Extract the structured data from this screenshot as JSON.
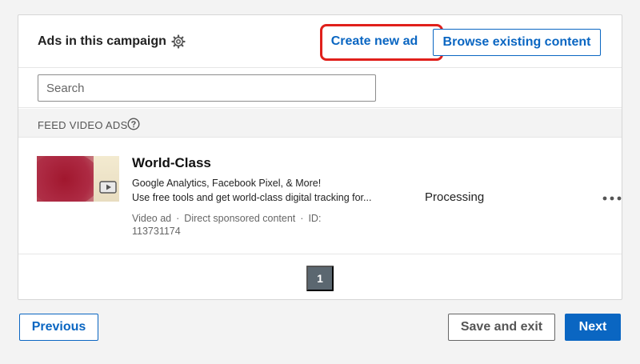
{
  "header": {
    "title": "Ads in this campaign",
    "create_label": "Create new ad",
    "browse_label": "Browse existing content"
  },
  "search": {
    "placeholder": "Search"
  },
  "section": {
    "label": "FEED VIDEO ADS"
  },
  "ad": {
    "title": "World-Class",
    "line1": "Google Analytics, Facebook Pixel, & More!",
    "line2": "Use free tools and get world-class digital tracking for...",
    "type": "Video ad",
    "format": "Direct sponsored content",
    "id_label": "ID:",
    "id_value": "113731174",
    "status": "Processing"
  },
  "pagination": {
    "current": "1"
  },
  "footer": {
    "previous_label": "Previous",
    "save_exit_label": "Save and exit",
    "next_label": "Next"
  },
  "icons": {
    "settings": "gear-icon",
    "help": "question-circle-icon",
    "video": "play-icon",
    "more": "ellipsis-icon"
  },
  "colors": {
    "brand_blue": "#0a66c2",
    "highlight_red": "#e0201b",
    "page_button": "#5b6770"
  }
}
